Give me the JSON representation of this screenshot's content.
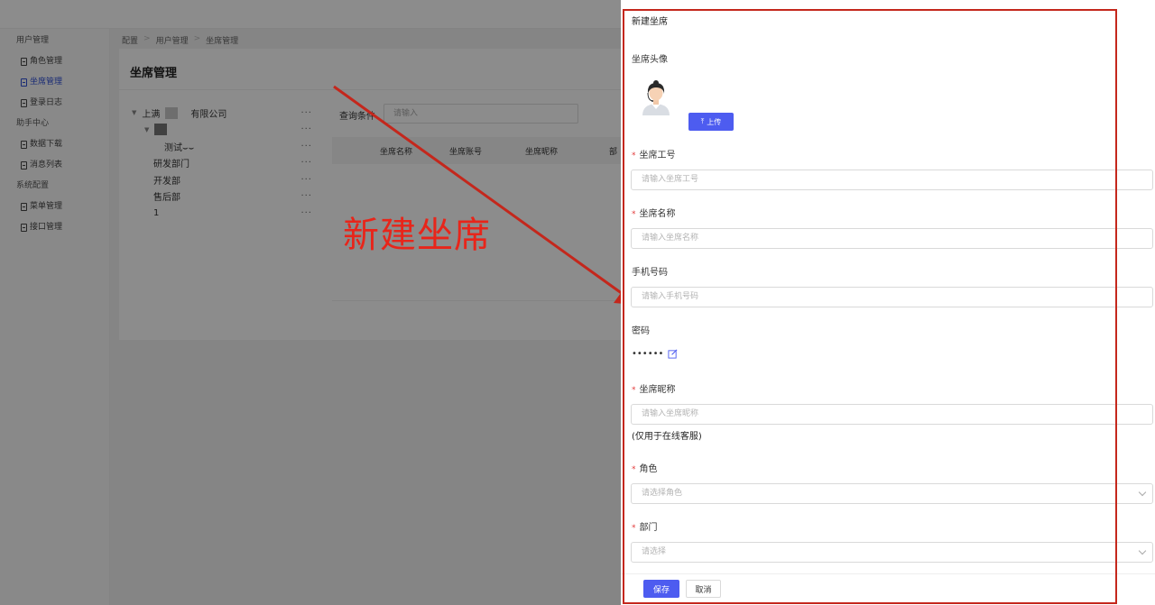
{
  "sidebar": {
    "groups": [
      {
        "title": "用户管理",
        "items": [
          "角色管理",
          "坐席管理",
          "登录日志"
        ]
      },
      {
        "title": "助手中心",
        "items": [
          "数据下载",
          "消息列表"
        ]
      },
      {
        "title": "系统配置",
        "items": [
          "菜单管理",
          "接口管理"
        ]
      }
    ]
  },
  "breadcrumb": [
    "配置",
    "用户管理",
    "坐席管理"
  ],
  "page": {
    "title": "坐席管理"
  },
  "tree": {
    "root": {
      "prefix": "上满",
      "suffix": "有限公司"
    },
    "child_label": "测试⌣⌣",
    "items": [
      "研发部门",
      "开发部",
      "售后部",
      "1"
    ],
    "more": "···"
  },
  "query": {
    "label": "查询条件",
    "placeholder": "请输入"
  },
  "table": {
    "columns": [
      "坐席名称",
      "坐席账号",
      "坐席昵称",
      "部"
    ]
  },
  "annotation": {
    "text": "新建坐席",
    "color": "#e8251a"
  },
  "drawer": {
    "title": "新建坐席",
    "avatar_label": "坐席头像",
    "upload_label": "上传",
    "fields": {
      "employee_id": {
        "label": "坐席工号",
        "placeholder": "请输入坐席工号",
        "required": true
      },
      "name": {
        "label": "坐席名称",
        "placeholder": "请输入坐席名称",
        "required": true
      },
      "phone": {
        "label": "手机号码",
        "placeholder": "请输入手机号码",
        "required": false
      },
      "password": {
        "label": "密码",
        "value": "••••••"
      },
      "nickname": {
        "label": "坐席昵称",
        "placeholder": "请输入坐席昵称",
        "required": true,
        "note": "(仅用于在线客服)"
      },
      "role": {
        "label": "角色",
        "placeholder": "请选择角色",
        "required": true
      },
      "department": {
        "label": "部门",
        "placeholder": "请选择",
        "required": true
      }
    },
    "required_mark": "*",
    "save_label": "保存",
    "cancel_label": "取消"
  },
  "colors": {
    "primary": "#4d5cf0",
    "annotation_red": "#c4271c"
  }
}
